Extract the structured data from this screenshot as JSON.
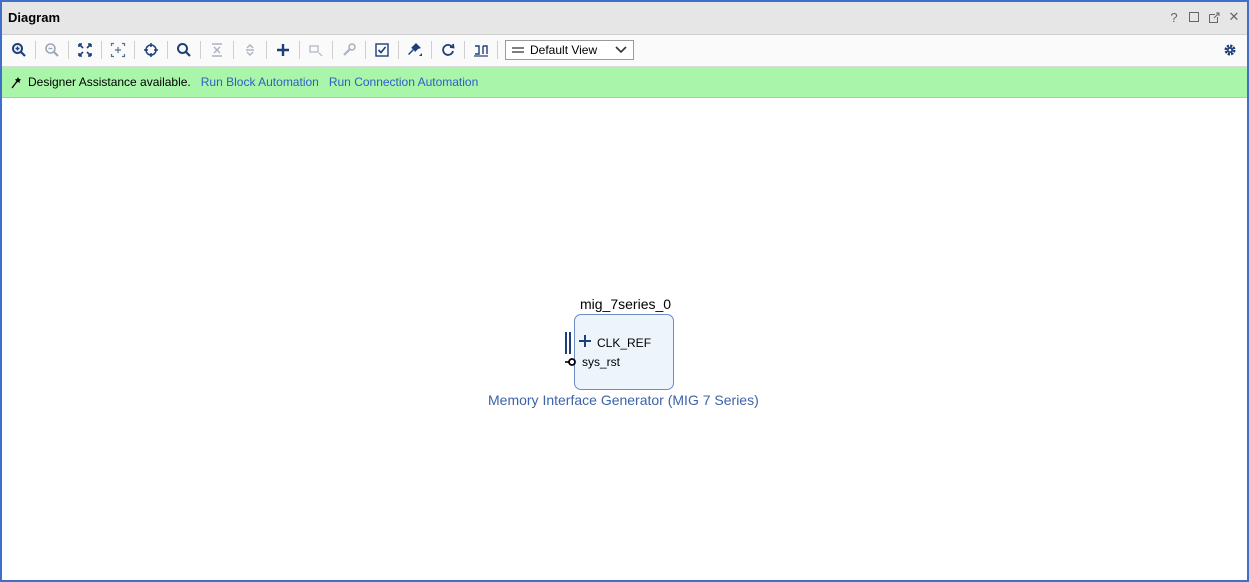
{
  "window": {
    "title": "Diagram",
    "controls": {
      "help": "?",
      "maximize_icon": "maximize-icon",
      "float_icon": "float-icon",
      "close": "✕"
    }
  },
  "toolbar": {
    "icons": [
      "zoom-in-icon",
      "zoom-out-icon",
      "fit-view-icon",
      "zoom-area-icon",
      "center-icon",
      "search-icon",
      "collapse-all-icon",
      "expand-all-icon",
      "add-ip-icon",
      "add-module-icon",
      "properties-icon",
      "validate-icon",
      "pin-icon",
      "regenerate-layout-icon",
      "optimize-routing-icon"
    ],
    "view_select": {
      "selected": "Default View"
    },
    "settings_icon": "gear-icon"
  },
  "assistance": {
    "message": "Designer Assistance available.",
    "links": [
      "Run Block Automation",
      "Run Connection Automation"
    ]
  },
  "diagram": {
    "block": {
      "instance_name": "mig_7series_0",
      "ports": [
        {
          "name": "CLK_REF",
          "type": "interface"
        },
        {
          "name": "sys_rst",
          "type": "reset"
        }
      ],
      "description": "Memory Interface Generator (MIG 7 Series)"
    }
  },
  "colors": {
    "frame_border": "#3f6fc8",
    "assist_bg": "#a9f5a9",
    "link": "#2f5fc8",
    "block_fill": "#eef4fb",
    "block_border": "#6a8cc3",
    "block_description": "#3d63a8"
  }
}
